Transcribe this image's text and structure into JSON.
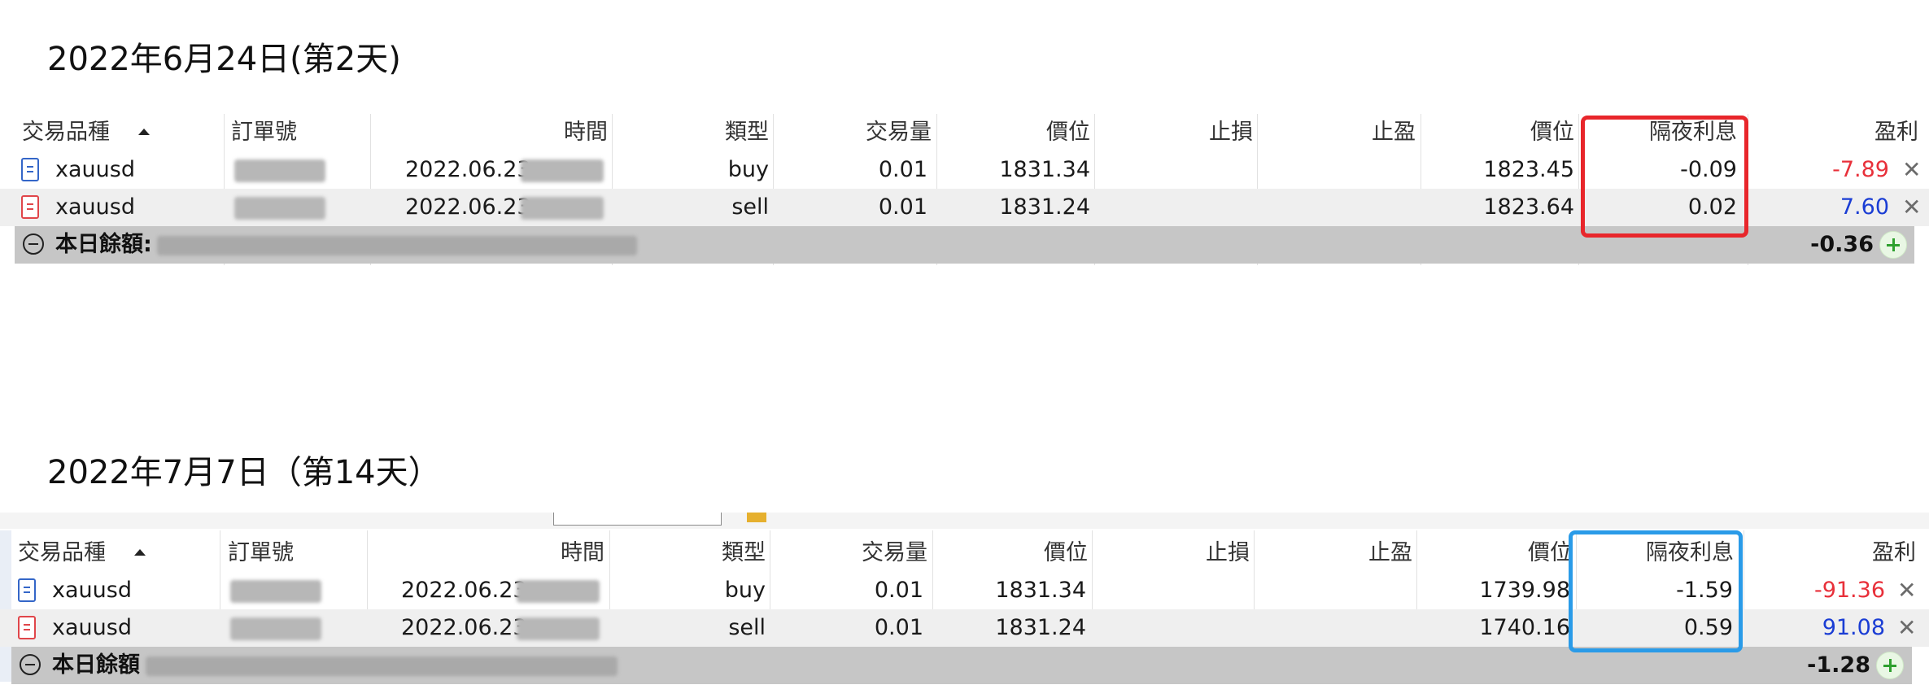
{
  "sections": [
    {
      "title": "2022年6月24日(第2天)",
      "headers": {
        "symbol": "交易品種",
        "ticket": "訂單號",
        "time": "時間",
        "type": "類型",
        "volume": "交易量",
        "open_price": "價位",
        "sl": "止損",
        "tp": "止盈",
        "price": "價位",
        "swap": "隔夜利息",
        "profit": "盈利"
      },
      "rows": [
        {
          "symbol": "xauusd",
          "ticket": "",
          "time": "2022.06.23",
          "type": "buy",
          "volume": "0.01",
          "open_price": "1831.34",
          "sl": "",
          "tp": "",
          "price": "1823.45",
          "swap": "-0.09",
          "profit": "-7.89"
        },
        {
          "symbol": "xauusd",
          "ticket": "",
          "time": "2022.06.23",
          "type": "sell",
          "volume": "0.01",
          "open_price": "1831.24",
          "sl": "",
          "tp": "",
          "price": "1823.64",
          "swap": "0.02",
          "profit": "7.60"
        }
      ],
      "summary": {
        "label": "本日餘額:",
        "total": "-0.36"
      },
      "highlight_color": "#e8262b"
    },
    {
      "title": "2022年7月7日（第14天）",
      "headers": {
        "symbol": "交易品種",
        "ticket": "訂單號",
        "time": "時間",
        "type": "類型",
        "volume": "交易量",
        "open_price": "價位",
        "sl": "止損",
        "tp": "止盈",
        "price": "價位",
        "swap": "隔夜利息",
        "profit": "盈利"
      },
      "rows": [
        {
          "symbol": "xauusd",
          "ticket": "",
          "time": "2022.06.23",
          "type": "buy",
          "volume": "0.01",
          "open_price": "1831.34",
          "sl": "",
          "tp": "",
          "price": "1739.98",
          "swap": "-1.59",
          "profit": "-91.36"
        },
        {
          "symbol": "xauusd",
          "ticket": "",
          "time": "2022.06.23",
          "type": "sell",
          "volume": "0.01",
          "open_price": "1831.24",
          "sl": "",
          "tp": "",
          "price": "1740.16",
          "swap": "0.59",
          "profit": "91.08"
        }
      ],
      "summary": {
        "label": "本日餘額",
        "total": "-1.28"
      },
      "highlight_color": "#2a9be8"
    }
  ],
  "icons": {
    "buy_order": "document-blue-icon",
    "sell_order": "document-red-icon",
    "close": "close-icon",
    "collapse": "minus-circle-icon",
    "add": "plus-circle-icon",
    "sort": "sort-up-icon"
  },
  "colors": {
    "negative_profit": "#e8303a",
    "positive_profit": "#1a3dd4",
    "summary_row_bg": "#c6c6c6"
  }
}
